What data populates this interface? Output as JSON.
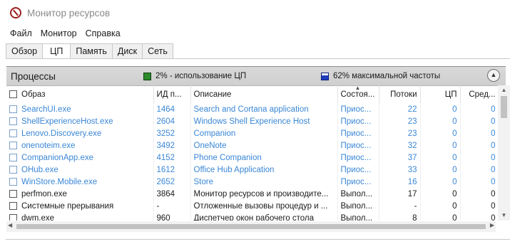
{
  "window": {
    "title": "Монитор ресурсов"
  },
  "menu": [
    "Файл",
    "Монитор",
    "Справка"
  ],
  "tabs": [
    {
      "label": "Обзор",
      "active": false
    },
    {
      "label": "ЦП",
      "active": true
    },
    {
      "label": "Память",
      "active": false
    },
    {
      "label": "Диск",
      "active": false
    },
    {
      "label": "Сеть",
      "active": false
    }
  ],
  "section": {
    "title": "Процессы",
    "cpu_usage": "2% - использование ЦП",
    "max_frequency": "62% максимальной частоты",
    "cpu_color": "#2c8a2c",
    "freq_color": "#1f3fbf"
  },
  "columns": [
    "Образ",
    "ИД п...",
    "Описание",
    "Состоя...",
    "Потоки",
    "ЦП",
    "Сред..."
  ],
  "rows": [
    {
      "image": "SearchUI.exe",
      "pid": "1464",
      "desc": "Search and Cortana application",
      "state": "Приос...",
      "threads": "22",
      "cpu": "0",
      "avg": "0",
      "suspended": true
    },
    {
      "image": "ShellExperienceHost.exe",
      "pid": "2604",
      "desc": "Windows Shell Experience Host",
      "state": "Приос...",
      "threads": "23",
      "cpu": "0",
      "avg": "0",
      "suspended": true
    },
    {
      "image": "Lenovo.Discovery.exe",
      "pid": "3252",
      "desc": "Companion",
      "state": "Приос...",
      "threads": "23",
      "cpu": "0",
      "avg": "0",
      "suspended": true
    },
    {
      "image": "onenoteim.exe",
      "pid": "3492",
      "desc": "OneNote",
      "state": "Приос...",
      "threads": "32",
      "cpu": "0",
      "avg": "0",
      "suspended": true
    },
    {
      "image": "CompanionApp.exe",
      "pid": "4152",
      "desc": "Phone Companion",
      "state": "Приос...",
      "threads": "37",
      "cpu": "0",
      "avg": "0",
      "suspended": true
    },
    {
      "image": "OHub.exe",
      "pid": "1612",
      "desc": "Office Hub Application",
      "state": "Приос...",
      "threads": "33",
      "cpu": "0",
      "avg": "0",
      "suspended": true
    },
    {
      "image": "WinStore.Mobile.exe",
      "pid": "2652",
      "desc": "Store",
      "state": "Приос...",
      "threads": "16",
      "cpu": "0",
      "avg": "0",
      "suspended": true
    },
    {
      "image": "perfmon.exe",
      "pid": "3864",
      "desc": "Монитор ресурсов и производите...",
      "state": "Выпол...",
      "threads": "17",
      "cpu": "0",
      "avg": "0",
      "suspended": false
    },
    {
      "image": "Системные прерывания",
      "pid": "-",
      "desc": "Отложенные вызовы процедур и ...",
      "state": "Выпол...",
      "threads": "-",
      "cpu": "0",
      "avg": "0",
      "suspended": false
    },
    {
      "image": "dwm.exe",
      "pid": "960",
      "desc": "Диспетчер окон рабочего стола",
      "state": "Выпол...",
      "threads": "8",
      "cpu": "0",
      "avg": "0",
      "suspended": false
    }
  ]
}
